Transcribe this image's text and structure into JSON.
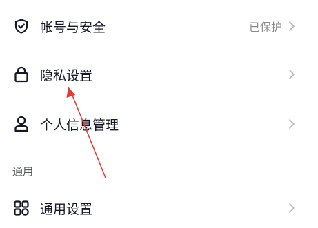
{
  "settings": {
    "account_security": {
      "label": "帐号与安全",
      "status": "已保护",
      "icon": "shield-check-icon"
    },
    "privacy": {
      "label": "隐私设置",
      "icon": "lock-icon"
    },
    "personal_info": {
      "label": "个人信息管理",
      "icon": "person-icon"
    },
    "general_section": {
      "title": "通用"
    },
    "general": {
      "label": "通用设置",
      "icon": "grid-icon"
    }
  },
  "annotation": {
    "arrow_color": "#e53935"
  }
}
